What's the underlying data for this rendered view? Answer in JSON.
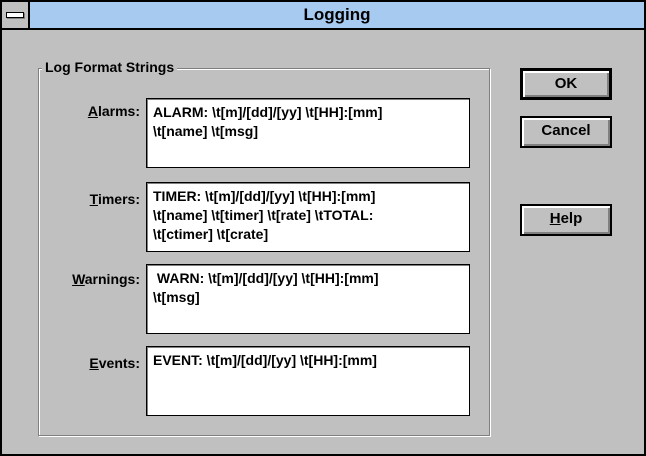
{
  "window": {
    "title": "Logging"
  },
  "group": {
    "label": "Log Format Strings"
  },
  "fields": {
    "alarms": {
      "label_mnemonic": "A",
      "label_rest": "larms:",
      "value": "ALARM: \\t[m]/[dd]/[yy] \\t[HH]:[mm]\n\\t[name] \\t[msg]"
    },
    "timers": {
      "label_mnemonic": "T",
      "label_rest": "imers:",
      "value": "TIMER: \\t[m]/[dd]/[yy] \\t[HH]:[mm]\n\\t[name] \\t[timer] \\t[rate] \\tTOTAL:\n\\t[ctimer] \\t[crate]"
    },
    "warnings": {
      "label_mnemonic": "W",
      "label_rest": "arnings:",
      "value": " WARN: \\t[m]/[dd]/[yy] \\t[HH]:[mm]\n\\t[msg]"
    },
    "events": {
      "label_mnemonic": "E",
      "label_rest": "vents:",
      "value": "EVENT: \\t[m]/[dd]/[yy] \\t[HH]:[mm]"
    }
  },
  "buttons": {
    "ok": "OK",
    "cancel": "Cancel",
    "help_mnemonic": "H",
    "help_rest": "elp"
  },
  "colors": {
    "titlebar": "#a6caf0",
    "face": "#c0c0c0"
  }
}
